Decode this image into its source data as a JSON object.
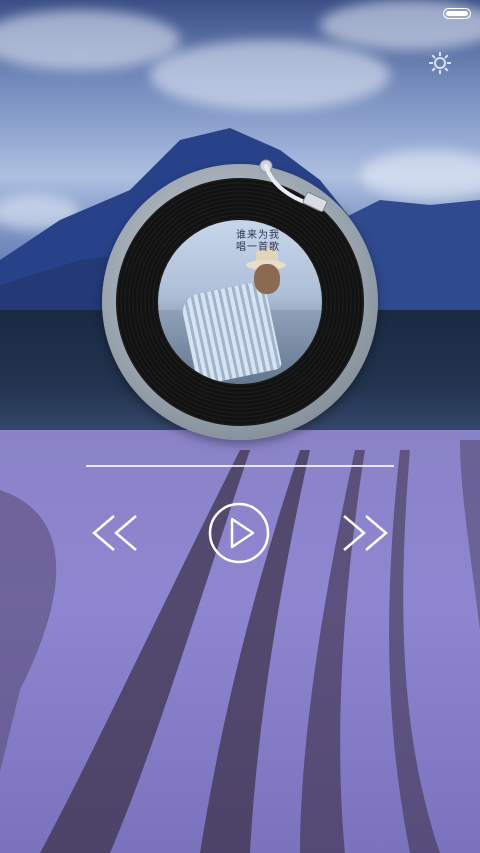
{
  "status_bar": {
    "battery_icon": "battery-icon",
    "battery_level": 1.0
  },
  "settings": {
    "icon": "gear-icon"
  },
  "album": {
    "cover_title_lines": [
      "谁来为我",
      "唱一首歌"
    ],
    "turntable_icon": "tonearm-icon"
  },
  "player": {
    "progress": 0.0,
    "prev_icon": "rewind-icon",
    "play_icon": "play-icon",
    "next_icon": "fast-forward-icon"
  },
  "colors": {
    "controls": "#ffffff",
    "field": "#8a83c8",
    "sky": "#6f86b8"
  }
}
